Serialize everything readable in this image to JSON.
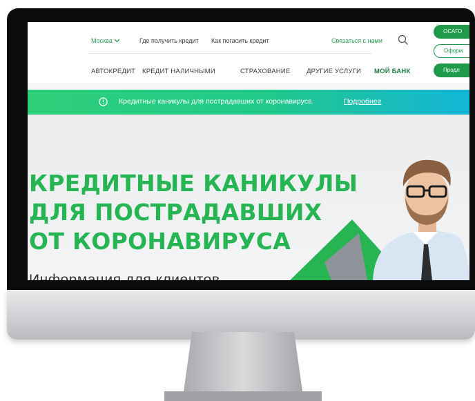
{
  "nav": {
    "city": "Москва",
    "links": [
      "Где получить кредит",
      "Как погасить кредит"
    ],
    "contact": "Связаться с нами",
    "menu": [
      "АВТОКРЕДИТ",
      "КРЕДИТ НАЛИЧНЫМИ",
      "СТРАХОВАНИЕ",
      "ДРУГИЕ УСЛУГИ"
    ],
    "my_bank": "МОЙ БАНК"
  },
  "side_buttons": [
    "ОСАГО",
    "Оформ",
    "Продл"
  ],
  "banner": {
    "text": "Кредитные каникулы для пострадавших от коронавируса",
    "link": "Подробнее"
  },
  "hero": {
    "line1": "КРЕДИТНЫЕ КАНИКУЛЫ",
    "line2": "ДЛЯ ПОСТРАДАВШИХ",
    "line3": "ОТ КОРОНАВИРУСА",
    "subtitle": "Информация для клиентов"
  },
  "colors": {
    "brand_green": "#27b554",
    "banner_start": "#2fd07a",
    "banner_end": "#13b5d8"
  }
}
